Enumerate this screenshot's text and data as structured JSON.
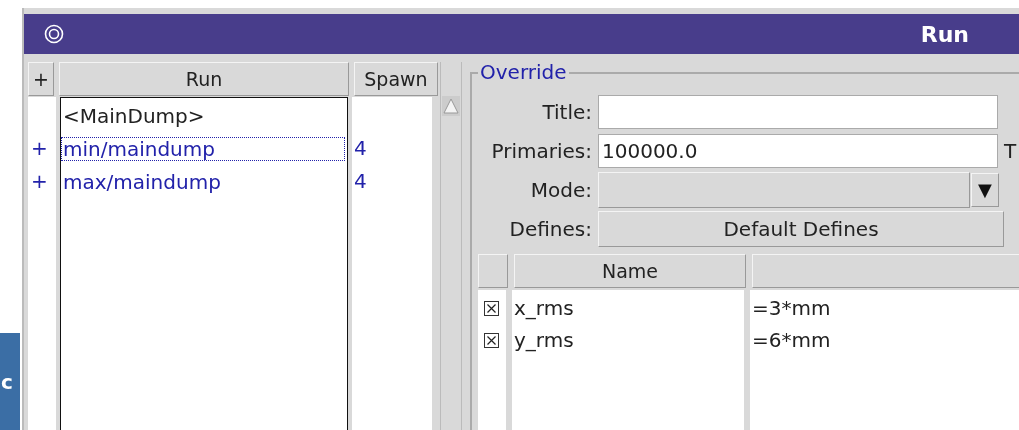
{
  "background": {
    "fragment": "c"
  },
  "window": {
    "title": "Run"
  },
  "runs": {
    "add_button": "+",
    "columns": [
      "Run",
      "Spawn"
    ],
    "rows": [
      {
        "kind": "default",
        "name": "<MainDump>",
        "selected": false
      },
      {
        "kind": "run",
        "expander": "+",
        "name": "min/maindump",
        "spawn": "4",
        "selected": true
      },
      {
        "kind": "run",
        "expander": "+",
        "name": "max/maindump",
        "spawn": "4",
        "selected": false
      }
    ]
  },
  "override": {
    "legend": "Override",
    "title": {
      "label": "Title:"
    },
    "primaries": {
      "label": "Primaries:",
      "value": "100000.0",
      "trailing_label": "T"
    },
    "mode": {
      "label": "Mode:",
      "arrow": "▼"
    },
    "defines": {
      "label": "Defines:",
      "button": "Default Defines"
    },
    "table": {
      "columns": [
        "Name"
      ],
      "rows": [
        {
          "checked": true,
          "name": "x_rms",
          "value": "=3*mm"
        },
        {
          "checked": true,
          "name": "y_rms",
          "value": "=6*mm"
        }
      ]
    }
  }
}
